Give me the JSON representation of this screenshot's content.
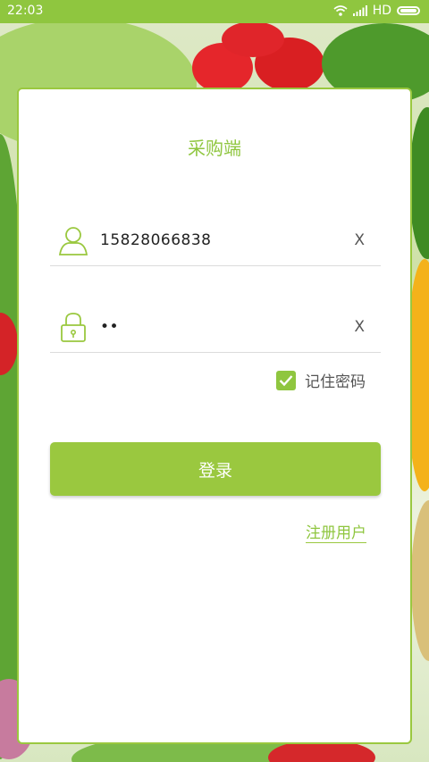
{
  "status_bar": {
    "time": "22:03",
    "network": "HD"
  },
  "title": "采购端",
  "username": {
    "value": "15828066838",
    "clear_label": "X"
  },
  "password": {
    "value": "••",
    "clear_label": "X"
  },
  "remember": {
    "label": "记住密码",
    "checked": true
  },
  "login_button": {
    "label": "登录"
  },
  "register_link": {
    "label": "注册用户"
  },
  "colors": {
    "accent": "#8fc63f",
    "button": "#9ac83f"
  },
  "icons": {
    "user": "user-icon",
    "lock": "lock-icon",
    "check": "check-icon",
    "wifi": "wifi-icon",
    "signal": "signal-icon",
    "battery": "battery-icon"
  }
}
